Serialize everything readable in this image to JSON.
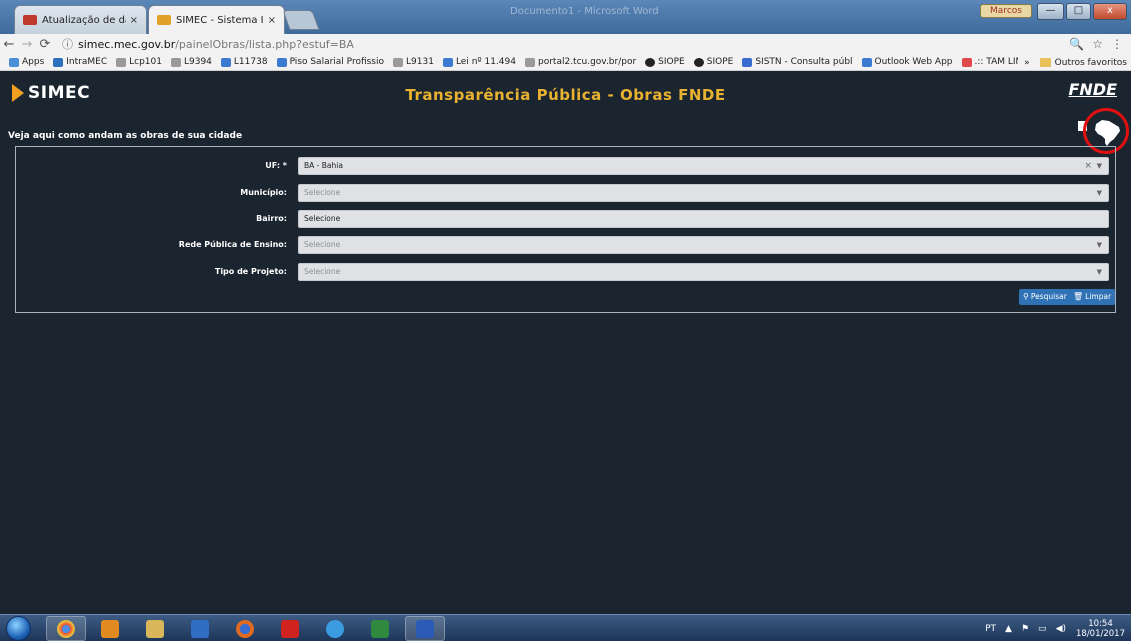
{
  "browser": {
    "tabs": [
      {
        "title": "Atualização de dados - I",
        "active": false,
        "close": "×"
      },
      {
        "title": "SIMEC - Sistema Integra",
        "active": true,
        "close": "×"
      }
    ],
    "window_title": "Documento1 - Microsoft Word",
    "window_user": "Marcos",
    "window_controls": {
      "minimize": "—",
      "maximize": "□",
      "close": "x"
    },
    "url": {
      "domain": "simec.mec.gov.br",
      "path": "/painelObras/lista.php?estuf=BA"
    },
    "address_icons": {
      "zoom": "🔍",
      "star": "☆",
      "menu": "⋮"
    },
    "bookmarks": [
      {
        "label": "Apps",
        "color": "#4a90d9"
      },
      {
        "label": "IntraMEC",
        "color": "#2c6fbd"
      },
      {
        "label": "Lcp101",
        "color": "#9a9a9a"
      },
      {
        "label": "L9394",
        "color": "#9a9a9a"
      },
      {
        "label": "L11738",
        "color": "#3a7ad1"
      },
      {
        "label": "Piso Salarial Profissio",
        "color": "#3a7ad1"
      },
      {
        "label": "L9131",
        "color": "#9a9a9a"
      },
      {
        "label": "Lei nº 11.494",
        "color": "#3a7ad1"
      },
      {
        "label": "portal2.tcu.gov.br/por",
        "color": "#9a9a9a"
      },
      {
        "label": "SIOPE",
        "color": "#222222"
      },
      {
        "label": "SIOPE",
        "color": "#222222"
      },
      {
        "label": "SISTN - Consulta públ",
        "color": "#3a6bd0"
      },
      {
        "label": "Outlook Web App",
        "color": "#3a7ad1"
      },
      {
        "label": ".:: TAM LINHAS AÉRE",
        "color": "#e04a4a"
      }
    ],
    "bookmarks_more": "»",
    "other_favorites": "Outros favoritos"
  },
  "page": {
    "logo_text": "SIMEC",
    "title": "Transparência Pública - Obras FNDE",
    "fnde_logo": "FNDE",
    "subtitle": "Veja aqui como andam as obras de sua cidade",
    "form": {
      "fields": [
        {
          "label": "UF: *",
          "value": "BA - Bahia",
          "placeholder": false,
          "clear": "×",
          "caret": "▼"
        },
        {
          "label": "Município:",
          "value": "Selecione",
          "placeholder": true,
          "caret": "▼"
        },
        {
          "label": "Bairro:",
          "value": "Selecione",
          "placeholder": false
        },
        {
          "label": "Rede Pública de Ensino:",
          "value": "Selecione",
          "placeholder": true,
          "caret": "▼"
        },
        {
          "label": "Tipo de Projeto:",
          "value": "Selecione",
          "placeholder": true,
          "caret": "▼"
        }
      ],
      "search_button": "Pesquisar",
      "search_icon": "search-icon",
      "clear_button": "Limpar",
      "clear_icon": "trash-icon"
    }
  },
  "taskbar": {
    "apps": [
      {
        "name": "chrome-icon",
        "color": "#e44b3a",
        "active": true
      },
      {
        "name": "outlook-icon",
        "color": "#e08a20"
      },
      {
        "name": "explorer-icon",
        "color": "#d9b65a"
      },
      {
        "name": "media-player-icon",
        "color": "#2f6ec2"
      },
      {
        "name": "firefox-icon",
        "color": "#e06a20"
      },
      {
        "name": "acrobat-icon",
        "color": "#d0221f"
      },
      {
        "name": "internet-explorer-icon",
        "color": "#3a9be0"
      },
      {
        "name": "excel-icon",
        "color": "#2f8a3f"
      },
      {
        "name": "word-icon",
        "color": "#2b5bb6",
        "active": true
      }
    ],
    "language": "PT",
    "clock_time": "10:54",
    "clock_date": "18/01/2017"
  },
  "colors": {
    "page_bg": "#1b2530",
    "title": "#e8b230",
    "logo_arrow": "#f0a020",
    "button": "#2f72b6",
    "highlight_circle": "#e01010"
  }
}
